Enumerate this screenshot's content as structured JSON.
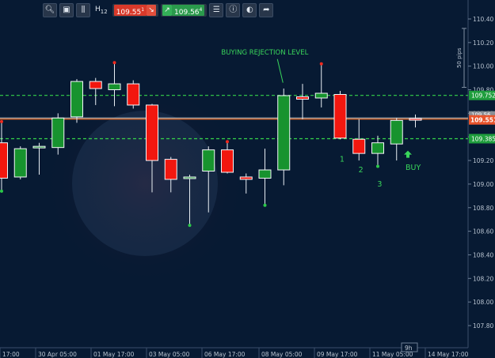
{
  "toolbar": {
    "timeframe": "H",
    "timeframe_sub": "12",
    "sell_price": "109.55",
    "sell_price_sup": "1",
    "buy_price": "109.56",
    "buy_price_sup": "4"
  },
  "colors": {
    "background": "#071a33",
    "bull": "#17932e",
    "bear": "#f2170f",
    "level": "#35d44a",
    "current": "#d8692c",
    "annotation": "#39d65b"
  },
  "chart_data": {
    "type": "candlestick",
    "title": "",
    "ylim": [
      107.6,
      110.5
    ],
    "y_ticks": [
      "110.40",
      "110.20",
      "110.00",
      "109.80",
      "109.60",
      "109.40",
      "109.20",
      "109.00",
      "108.80",
      "108.60",
      "108.40",
      "108.20",
      "108.00",
      "107.80"
    ],
    "x_labels": [
      "17:00",
      "30 Apr 05:00",
      "01 May 17:00",
      "03 May 05:00",
      "06 May 17:00",
      "08 May 05:00",
      "09 May 17:00",
      "11 May 05:00",
      "14 May 17:00"
    ],
    "candles": [
      {
        "o": 109.35,
        "h": 109.53,
        "l": 108.94,
        "c": 109.05
      },
      {
        "o": 109.06,
        "h": 109.32,
        "l": 109.04,
        "c": 109.3
      },
      {
        "o": 109.31,
        "h": 109.35,
        "l": 109.08,
        "c": 109.32
      },
      {
        "o": 109.31,
        "h": 109.6,
        "l": 109.25,
        "c": 109.56
      },
      {
        "o": 109.57,
        "h": 109.89,
        "l": 109.52,
        "c": 109.87
      },
      {
        "o": 109.87,
        "h": 109.9,
        "l": 109.67,
        "c": 109.81
      },
      {
        "o": 109.8,
        "h": 110.03,
        "l": 109.66,
        "c": 109.85
      },
      {
        "o": 109.85,
        "h": 109.88,
        "l": 109.64,
        "c": 109.67
      },
      {
        "o": 109.67,
        "h": 109.68,
        "l": 108.93,
        "c": 109.2
      },
      {
        "o": 109.21,
        "h": 109.23,
        "l": 108.93,
        "c": 109.04
      },
      {
        "o": 109.05,
        "h": 109.08,
        "l": 108.65,
        "c": 109.06
      },
      {
        "o": 109.11,
        "h": 109.32,
        "l": 108.76,
        "c": 109.29
      },
      {
        "o": 109.29,
        "h": 109.36,
        "l": 109.09,
        "c": 109.1
      },
      {
        "o": 109.06,
        "h": 109.09,
        "l": 108.92,
        "c": 109.04
      },
      {
        "o": 109.05,
        "h": 109.3,
        "l": 108.82,
        "c": 109.12
      },
      {
        "o": 109.12,
        "h": 109.81,
        "l": 108.99,
        "c": 109.75
      },
      {
        "o": 109.74,
        "h": 109.85,
        "l": 109.55,
        "c": 109.72
      },
      {
        "o": 109.73,
        "h": 110.02,
        "l": 109.65,
        "c": 109.77
      },
      {
        "o": 109.76,
        "h": 109.79,
        "l": 109.38,
        "c": 109.39
      },
      {
        "o": 109.38,
        "h": 109.55,
        "l": 109.2,
        "c": 109.26
      },
      {
        "o": 109.26,
        "h": 109.41,
        "l": 109.15,
        "c": 109.35
      },
      {
        "o": 109.34,
        "h": 109.56,
        "l": 109.2,
        "c": 109.54
      },
      {
        "o": 109.555,
        "h": 109.59,
        "l": 109.48,
        "c": 109.551
      }
    ],
    "marked_highs": [
      0,
      6,
      12,
      17
    ],
    "marked_lows": [
      0,
      10,
      14,
      20
    ],
    "levels": [
      {
        "price": 109.752,
        "label": "109.752"
      },
      {
        "price": 109.385,
        "label": "109.385"
      }
    ],
    "current_price": {
      "price": 109.551,
      "label": "109.551"
    },
    "current_price_shadow": "109.56",
    "annotations": [
      {
        "text": "BUYING REJECTION LEVEL",
        "x": 15.3,
        "y": 110.1
      },
      {
        "text": "1",
        "x": 18.1,
        "y": 109.19
      },
      {
        "text": "2",
        "x": 19.1,
        "y": 109.1
      },
      {
        "text": "3",
        "x": 20.1,
        "y": 108.98
      },
      {
        "text": "BUY",
        "x": 21.6,
        "y": 109.12
      }
    ],
    "buy_marker_candle": 21.6,
    "pips_label": "50 pips",
    "period_label": "9h"
  }
}
